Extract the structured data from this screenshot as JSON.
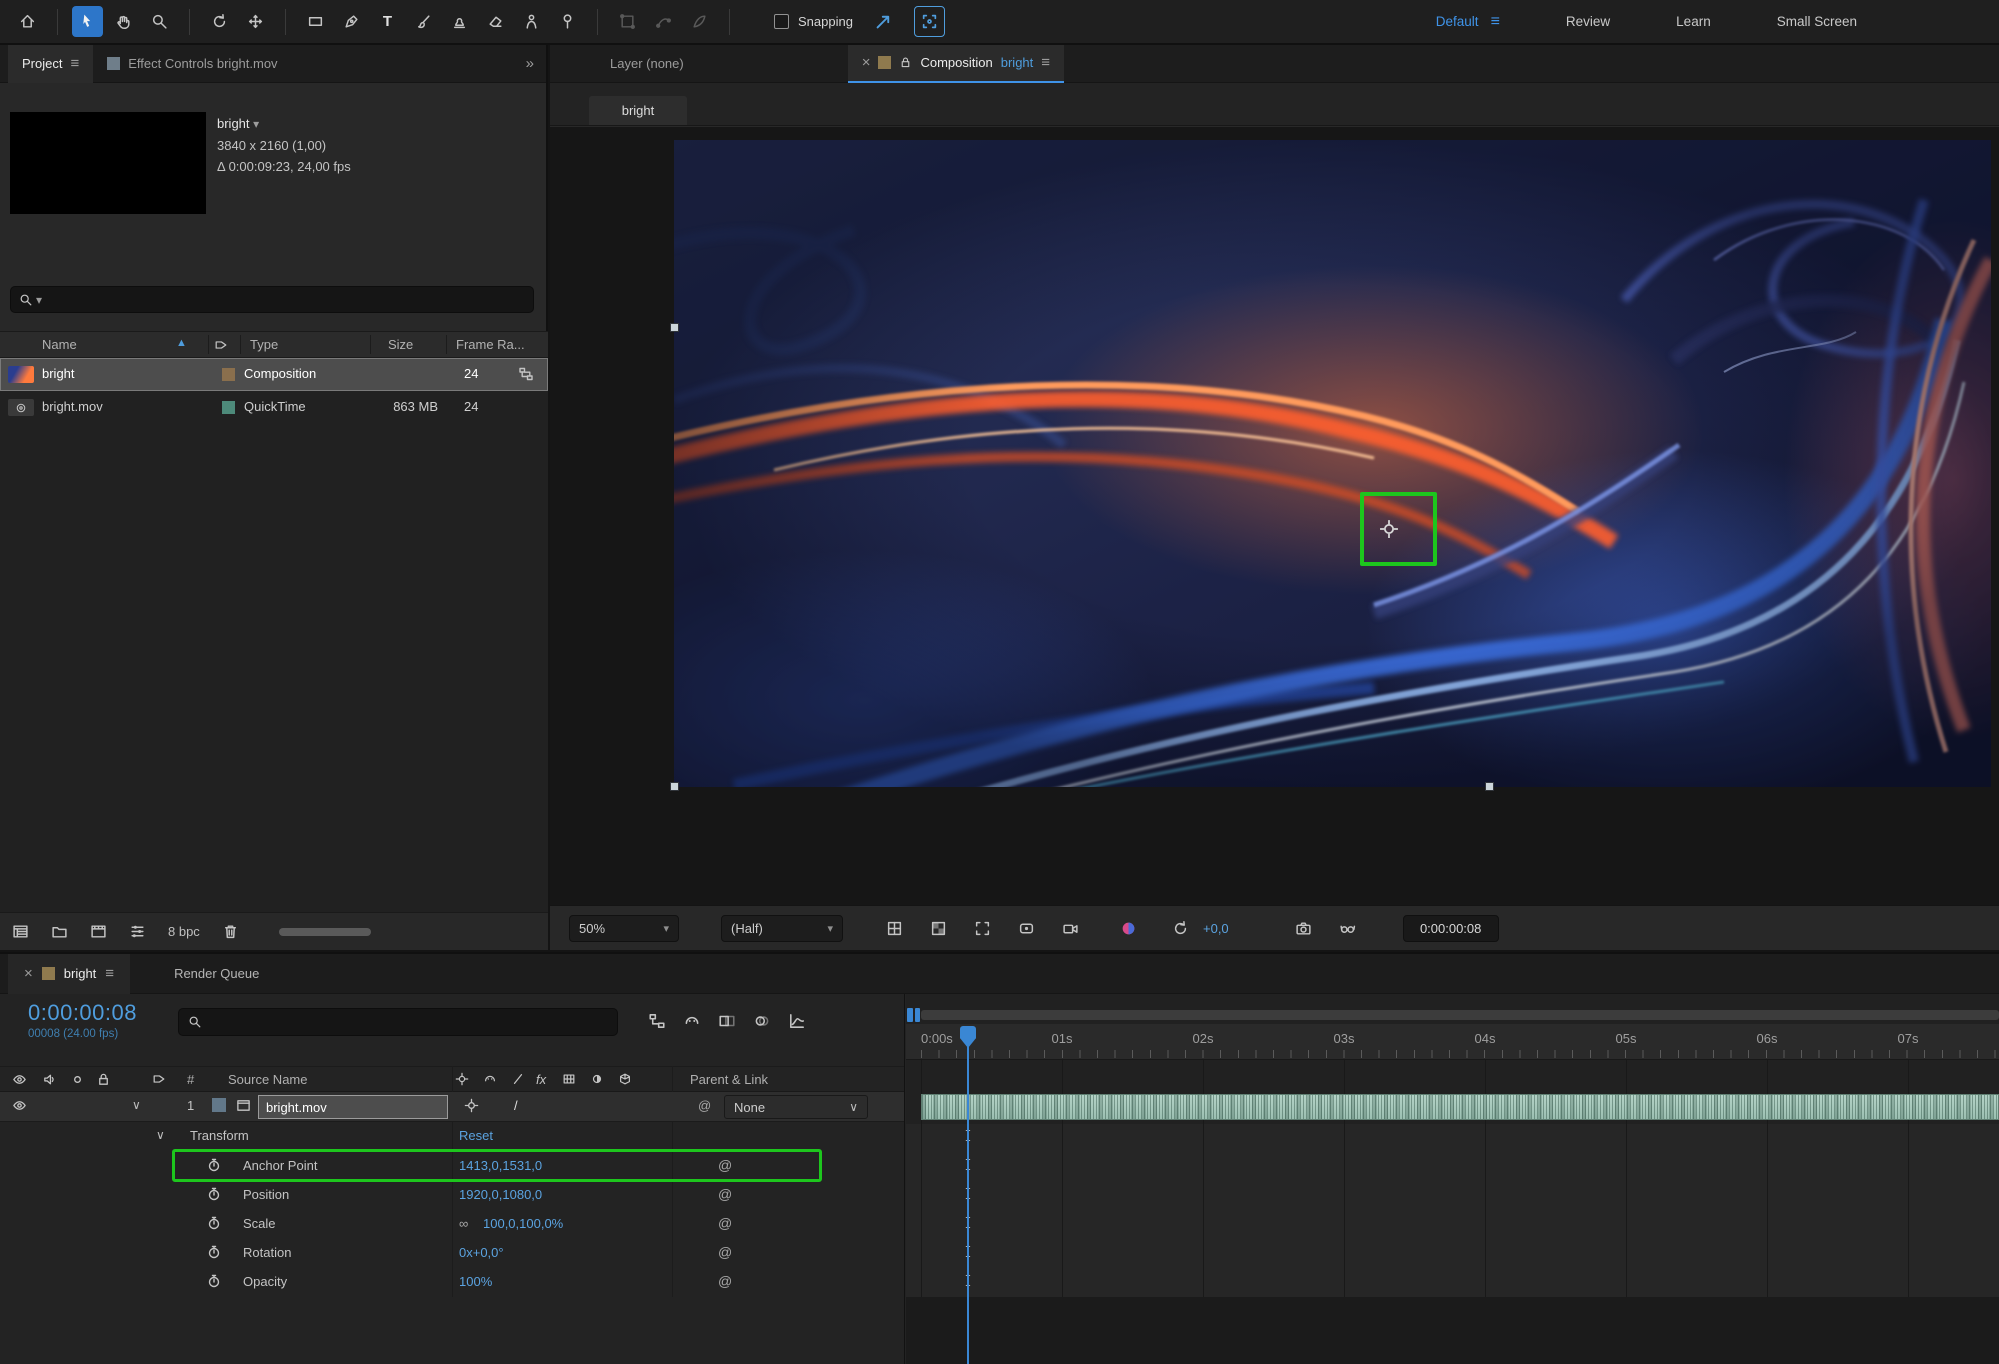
{
  "icons": {
    "close": "×",
    "menu": "≡",
    "overflow": "»",
    "caret_down": "∨",
    "dropdown_caret": "▾",
    "sort_asc": "▲",
    "pickwhip": "@",
    "slash": "/",
    "link": "∞",
    "type_tool": "T"
  },
  "toolbar": {
    "snapping_label": "Snapping",
    "workspaces": {
      "default": "Default",
      "review": "Review",
      "learn": "Learn",
      "small_screen": "Small Screen"
    }
  },
  "project_panel": {
    "tab_project": "Project",
    "tab_effect_controls": "Effect Controls bright.mov",
    "preview": {
      "name": "bright",
      "dimensions": "3840 x 2160 (1,00)",
      "duration": "Δ 0:00:09:23, 24,00 fps"
    },
    "columns": {
      "name": "Name",
      "type": "Type",
      "size": "Size",
      "frame_rate": "Frame Ra..."
    },
    "rows": [
      {
        "name": "bright",
        "type": "Composition",
        "size": "",
        "frame_rate": "24"
      },
      {
        "name": "bright.mov",
        "type": "QuickTime",
        "size": "863 MB",
        "frame_rate": "24"
      }
    ],
    "footer": {
      "bpc": "8 bpc"
    }
  },
  "comp_panel": {
    "tab_layer": "Layer (none)",
    "tab_composition_prefix": "Composition",
    "tab_composition_name": "bright",
    "viewer_tab": "bright",
    "footer": {
      "zoom": "50%",
      "resolution": "(Half)",
      "exposure": "+0,0",
      "time": "0:00:00:08"
    }
  },
  "timeline": {
    "tab_comp": "bright",
    "tab_render_queue": "Render Queue",
    "current_time": "0:00:00:08",
    "frame_info": "00008 (24.00 fps)",
    "columns": {
      "hash": "#",
      "source_name": "Source Name",
      "parent_link": "Parent & Link"
    },
    "layer": {
      "index": "1",
      "name": "bright.mov",
      "parent": "None"
    },
    "transform_group": {
      "name": "Transform",
      "reset": "Reset"
    },
    "properties": [
      {
        "name": "Anchor Point",
        "value": "1413,0,1531,0"
      },
      {
        "name": "Position",
        "value": "1920,0,1080,0"
      },
      {
        "name": "Scale",
        "value": "100,0,100,0%"
      },
      {
        "name": "Rotation",
        "value": "0x+0,0°"
      },
      {
        "name": "Opacity",
        "value": "100%"
      }
    ],
    "ruler": [
      "0:00s",
      "01s",
      "02s",
      "03s",
      "04s",
      "05s",
      "06s",
      "07s"
    ]
  }
}
